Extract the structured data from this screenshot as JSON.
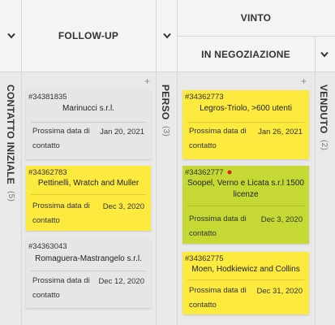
{
  "colors": {
    "card_gray": "#e6e6e6",
    "card_yellow": "#fdea3f",
    "card_green": "#c5d833",
    "flag_red": "#e02020"
  },
  "headers": {
    "follow_up": "FOLLOW-UP",
    "vinto": "VINTO",
    "in_negoziazione": "IN NEGOZIAZIONE"
  },
  "columns": {
    "contatto_iniziale": {
      "label": "CONTATTO INIZIALE",
      "count": "(5)"
    },
    "perso": {
      "label": "PERSO",
      "count": "(3)"
    },
    "venduto": {
      "label": "VENDUTO",
      "count": "(2)"
    }
  },
  "card_fields": {
    "next_contact_label": "Prossima data di contatto"
  },
  "follow_up_cards": [
    {
      "id": "#34381835",
      "title": "Marinucci s.r.l.",
      "date": "Jan 20, 2021",
      "color": "gray"
    },
    {
      "id": "#34362783",
      "title": "Pettinelli, Wratch and Muller",
      "date": "Dec 3, 2020",
      "color": "yellow"
    },
    {
      "id": "#34363043",
      "title": "Romaguera-Mastrangelo s.r.l.",
      "date": "Dec 12, 2020",
      "color": "gray"
    }
  ],
  "negoziazione_cards": [
    {
      "id": "#34362773",
      "title": "Legros-Triolo, >600 utenti",
      "date": "Jan 26, 2021",
      "color": "yellow"
    },
    {
      "id": "#34362777",
      "title": "Soopel, Verno e Licata s.r.l 1500 licenze",
      "date": "Dec 3, 2020",
      "color": "green",
      "flag": true
    },
    {
      "id": "#34362775",
      "title": "Moen, Hodkiewicz and Collins",
      "date": "Dec 31, 2020",
      "color": "yellow"
    }
  ]
}
